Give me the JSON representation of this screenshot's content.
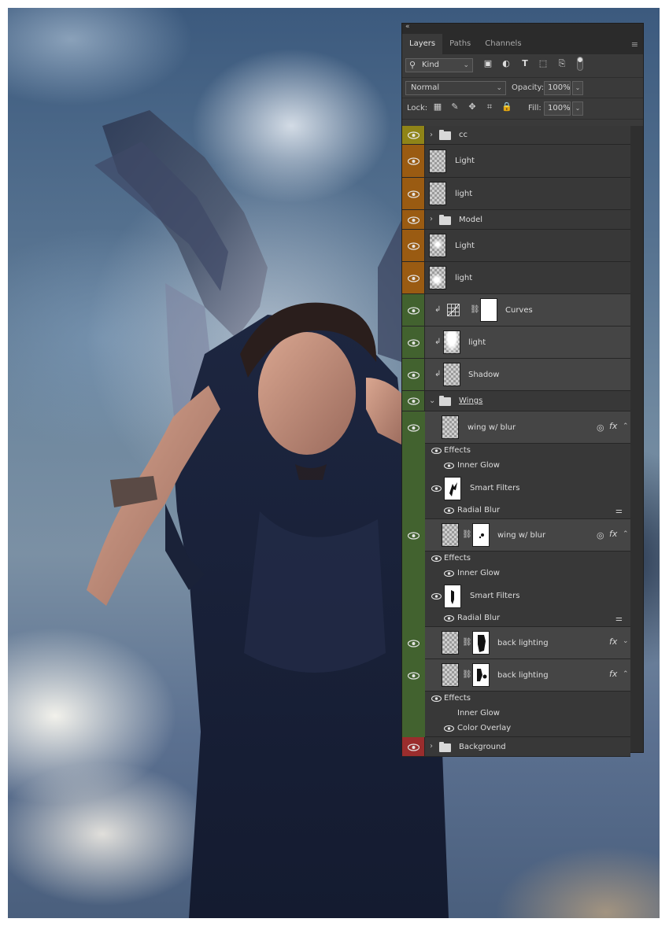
{
  "panel": {
    "collapse_icon": "double-chevron-left-icon",
    "tabs": [
      {
        "label": "Layers",
        "active": true
      },
      {
        "label": "Paths",
        "active": false
      },
      {
        "label": "Channels",
        "active": false
      }
    ],
    "menu_icon": "panel-menu-icon",
    "filter": {
      "kind_label": "Kind"
    },
    "blend_mode": "Normal",
    "opacity_label": "Opacity:",
    "opacity_value": "100%",
    "lock_label": "Lock:",
    "fill_label": "Fill:",
    "fill_value": "100%"
  },
  "colors": {
    "yellow": "#8f8418",
    "orange": "#9a5b12",
    "green": "#42622f",
    "red": "#9a2d2d"
  },
  "layers": {
    "cc": "cc",
    "light_1": "Light",
    "light_2": "light",
    "model": "Model",
    "light_3": "Light",
    "light_4": "light",
    "curves": "Curves",
    "light_5": "light",
    "shadow": "Shadow",
    "wings": "Wings",
    "wing_blur_1": "wing w/ blur",
    "wing_blur_1_effects": "Effects",
    "wing_blur_1_inner_glow": "Inner Glow",
    "wing_blur_1_smart_filters": "Smart Filters",
    "wing_blur_1_radial_blur": "Radial Blur",
    "wing_blur_2": "wing w/ blur",
    "wing_blur_2_effects": "Effects",
    "wing_blur_2_inner_glow": "Inner Glow",
    "wing_blur_2_smart_filters": "Smart Filters",
    "wing_blur_2_radial_blur": "Radial Blur",
    "back_lighting_1": "back lighting",
    "back_lighting_2": "back lighting",
    "back_lighting_2_effects": "Effects",
    "back_lighting_2_inner_glow": "Inner Glow",
    "back_lighting_2_color_overlay": "Color Overlay",
    "background": "Background"
  }
}
